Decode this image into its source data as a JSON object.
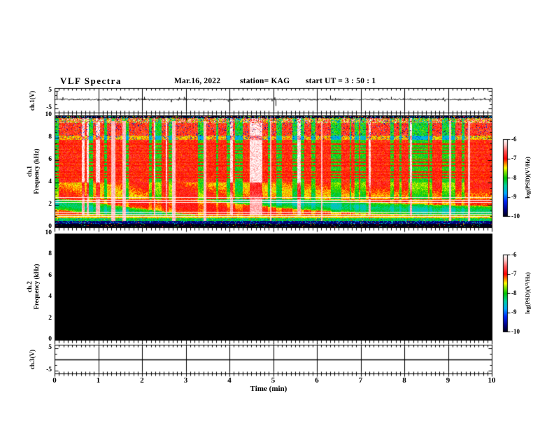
{
  "header": {
    "title": "VLF Spectra",
    "date": "Mar.16, 2022",
    "station": "station= KAG",
    "start_ut": "start UT =  3 : 50 : 1"
  },
  "xaxis": {
    "label": "Time (min)",
    "ticks": [
      "0",
      "1",
      "2",
      "3",
      "4",
      "5",
      "6",
      "7",
      "8",
      "9",
      "10"
    ],
    "range_min": [
      0,
      10
    ],
    "minor_step_min": 0.1
  },
  "panels": {
    "ch1_wave": {
      "name": "ch.1(V)",
      "ytick_labels": [
        "5",
        "-5"
      ],
      "ytick_values": [
        5,
        -5
      ],
      "ylim": [
        -6.9,
        6.9
      ]
    },
    "ch1_spec": {
      "name_line1": "ch.1",
      "name_line2": "Frequency (kHz)",
      "ytick_labels": [
        "10",
        "8",
        "6",
        "4",
        "2",
        "0"
      ],
      "ytick_values": [
        10,
        8,
        6,
        4,
        2,
        0
      ],
      "ylim": [
        0,
        10
      ]
    },
    "ch2_spec": {
      "name_line1": "ch.2",
      "name_line2": "Frequency (kHz)",
      "ytick_labels": [
        "10",
        "8",
        "6",
        "4",
        "2",
        "0"
      ],
      "ytick_values": [
        10,
        8,
        6,
        4,
        2,
        0
      ],
      "ylim": [
        0,
        10
      ]
    },
    "ch3_wave": {
      "name": "ch.3(V)",
      "ytick_labels": [
        "5",
        "-5"
      ],
      "ytick_values": [
        5,
        -5
      ],
      "ylim": [
        -6.4,
        6.4
      ]
    }
  },
  "colorbar": {
    "label": "log(PSD)(V²/Hz)",
    "tick_labels": [
      "-6",
      "-7",
      "-8",
      "-9",
      "-10"
    ],
    "tick_values": [
      -6,
      -7,
      -8,
      -9,
      -10
    ],
    "range": [
      -10,
      -6
    ],
    "stops": [
      [
        0.0,
        "#000014"
      ],
      [
        0.08,
        "#000080"
      ],
      [
        0.2,
        "#0028ff"
      ],
      [
        0.3,
        "#00aaff"
      ],
      [
        0.4,
        "#00d2a0"
      ],
      [
        0.5,
        "#00c800"
      ],
      [
        0.58,
        "#8ce600"
      ],
      [
        0.63,
        "#ffff00"
      ],
      [
        0.68,
        "#ff9600"
      ],
      [
        0.75,
        "#ff0000"
      ],
      [
        0.85,
        "#ff5a5a"
      ],
      [
        0.93,
        "#ffc8c8"
      ],
      [
        1.0,
        "#ffffff"
      ]
    ]
  },
  "chart_data": [
    {
      "type": "line",
      "title": "ch.1 voltage waveform",
      "xlabel": "Time (min)",
      "xlim": [
        0,
        10
      ],
      "ylabel": "ch.1(V)",
      "ylim": [
        -6.9,
        6.9
      ],
      "baseline_v": 0,
      "noise_amplitude_v": 0.45,
      "spike_rate": 0.04,
      "spikes": [
        {
          "t_min": 0.05,
          "v": 5.0
        },
        {
          "t_min": 2.05,
          "v": 1.6
        },
        {
          "t_min": 3.4,
          "v": -1.2
        },
        {
          "t_min": 5.05,
          "v": -3.6
        },
        {
          "t_min": 6.3,
          "v": 2.3
        },
        {
          "t_min": 7.7,
          "v": 1.5
        },
        {
          "t_min": 8.9,
          "v": 1.3
        }
      ]
    },
    {
      "type": "heatmap",
      "title": "ch.1 VLF spectrogram",
      "xlabel": "Time (min)",
      "xlim": [
        0,
        10
      ],
      "ylabel": "Frequency (kHz)",
      "ylim": [
        0,
        10
      ],
      "value_scale": {
        "label": "log(PSD)(V²/Hz)",
        "range": [
          -10,
          -6
        ]
      },
      "bands": [
        {
          "freq_khz": [
            9.78,
            10.0
          ],
          "appearance": "near-black with dense multicolour speckle"
        },
        {
          "freq_khz": [
            9.32,
            9.78
          ],
          "appearance": "chaotic red/green/cyan vertical streaks"
        },
        {
          "freq_khz": [
            8.18,
            9.32
          ],
          "appearance": "strong vertical streaks: red -6.9, green -8, white gaps -6.2"
        },
        {
          "freq_khz": [
            7.82,
            8.18
          ],
          "appearance": "darker horizontal band with green/blue patches"
        },
        {
          "freq_khz": [
            4.0,
            7.82
          ],
          "appearance": "columnar red/green streaks crossed by thin red horizontal lines"
        },
        {
          "freq_khz": [
            2.5,
            4.0
          ],
          "appearance": "red/orange near -7 with green columns and yellow patches"
        },
        {
          "freq_khz": [
            1.05,
            2.5
          ],
          "appearance": "intense red near -6.9 with green patches and bright white horizontal lines"
        },
        {
          "freq_khz": [
            0.82,
            1.05
          ],
          "appearance": "orange/yellow band near -7.4"
        },
        {
          "freq_khz": [
            0.56,
            0.82
          ],
          "appearance": "green band near -8.2 with colour speckle"
        },
        {
          "freq_khz": [
            0.3,
            0.56
          ],
          "appearance": "dark navy near -9.7 with blue speckle"
        },
        {
          "freq_khz": [
            0.0,
            0.3
          ],
          "appearance": "black near -10 with sparse speckle"
        }
      ],
      "white_hlines_khz": [
        2.65,
        2.4,
        2.2,
        1.35,
        1.15,
        0.95
      ],
      "red_hlines_khz": [
        4.45,
        4.7,
        4.95,
        5.5,
        5.8,
        6.1,
        6.6,
        6.85,
        7.1,
        7.45
      ],
      "bright_column_rate": 0.05,
      "column_type_probs": {
        "red": 0.58,
        "green": 0.34,
        "white": 0.08
      }
    },
    {
      "type": "heatmap",
      "title": "ch.2 VLF spectrogram",
      "xlabel": "Time (min)",
      "xlim": [
        0,
        10
      ],
      "ylabel": "Frequency (kHz)",
      "ylim": [
        0,
        10
      ],
      "value_scale": {
        "label": "log(PSD)(V²/Hz)",
        "range": [
          -10,
          -6
        ]
      },
      "values": "uniform black — no signal above -10 over entire panel",
      "fill": "#000000"
    },
    {
      "type": "line",
      "title": "ch.3 voltage waveform",
      "xlabel": "Time (min)",
      "xlim": [
        0,
        10
      ],
      "ylabel": "ch.3(V)",
      "ylim": [
        -6.4,
        6.4
      ],
      "values": "constant 0 V flat line"
    }
  ]
}
